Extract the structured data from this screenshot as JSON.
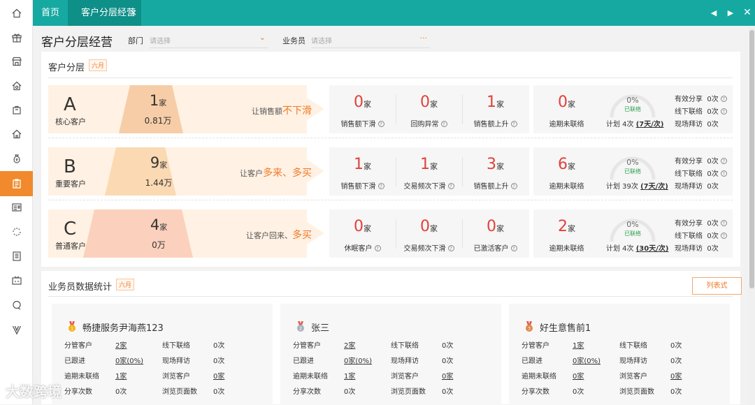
{
  "tabs": {
    "home": "首页",
    "current": "客户分层经营",
    "close": "×"
  },
  "page": {
    "title": "客户分层经营"
  },
  "filters": {
    "dept_label": "部门",
    "dept_placeholder": "请选择",
    "sales_label": "业务员",
    "sales_placeholder": "请选择",
    "sales_dots": "···"
  },
  "tiering": {
    "title": "客户分层",
    "month": "六月",
    "rows": [
      {
        "letter": "A",
        "name": "核心客户",
        "count": "1",
        "unit": "家",
        "amount": "0.81万",
        "slogan_pre": "让销售额",
        "slogan_hl": "不下滑",
        "metrics": [
          {
            "value": "0",
            "unit": "家",
            "label": "销售额下滑"
          },
          {
            "value": "0",
            "unit": "家",
            "label": "回购异常"
          },
          {
            "value": "1",
            "unit": "家",
            "label": "销售额上升"
          }
        ],
        "overdue": {
          "value": "0",
          "unit": "家",
          "label": "逾期未联络"
        },
        "gauge": {
          "pct": "0%",
          "tag": "已联络",
          "percent": 0
        },
        "plan_pre": "计划 4次 ",
        "plan_link": "(7天/次)",
        "stats": [
          {
            "label": "有效分享",
            "value": "0次"
          },
          {
            "label": "线下联络",
            "value": "0次"
          },
          {
            "label": "现场拜访",
            "value": "0次"
          }
        ]
      },
      {
        "letter": "B",
        "name": "重要客户",
        "count": "9",
        "unit": "家",
        "amount": "1.44万",
        "slogan_pre": "让客户",
        "slogan_hl": "多来、多买",
        "metrics": [
          {
            "value": "1",
            "unit": "家",
            "label": "销售额下滑"
          },
          {
            "value": "1",
            "unit": "家",
            "label": "交易频次下滑"
          },
          {
            "value": "3",
            "unit": "家",
            "label": "销售额上升"
          }
        ],
        "overdue": {
          "value": "6",
          "unit": "家",
          "label": "逾期未联络"
        },
        "gauge": {
          "pct": "0%",
          "tag": "已联络",
          "percent": 0
        },
        "plan_pre": "计划 39次 ",
        "plan_link": "(7天/次)",
        "stats": [
          {
            "label": "有效分享",
            "value": "0次"
          },
          {
            "label": "线下联络",
            "value": "0次"
          },
          {
            "label": "现场拜访",
            "value": "0次"
          }
        ]
      },
      {
        "letter": "C",
        "name": "普通客户",
        "count": "4",
        "unit": "家",
        "amount": "0万",
        "slogan_pre": "让客户回来、",
        "slogan_hl": "多买",
        "metrics": [
          {
            "value": "0",
            "unit": "家",
            "label": "休眠客户"
          },
          {
            "value": "0",
            "unit": "家",
            "label": "交易频次下滑"
          },
          {
            "value": "0",
            "unit": "家",
            "label": "已激活客户"
          }
        ],
        "overdue": {
          "value": "2",
          "unit": "家",
          "label": "逾期未联络"
        },
        "gauge": {
          "pct": "0%",
          "tag": "已联络",
          "percent": 0
        },
        "plan_pre": "计划 4次 ",
        "plan_link": "(30天/次)",
        "stats": [
          {
            "label": "有效分享",
            "value": "0次"
          },
          {
            "label": "线下联络",
            "value": "0次"
          },
          {
            "label": "现场拜访",
            "value": "0次"
          }
        ]
      }
    ]
  },
  "sales_stats": {
    "title": "业务员数据统计",
    "month": "六月",
    "list_button": "列表式",
    "cards": [
      {
        "name": "畅捷服务尹海燕123",
        "rank_color": "#f2b51c",
        "kv": [
          {
            "k": "分管客户",
            "v": "2家"
          },
          {
            "k": "线下联络",
            "v": "0次"
          },
          {
            "k": "已跟进",
            "v": "0家(0%)"
          },
          {
            "k": "现场拜访",
            "v": "0次"
          },
          {
            "k": "逾期未联络",
            "v": "1家"
          },
          {
            "k": "浏览客户",
            "v": "0家"
          },
          {
            "k": "分享次数",
            "v": "0次"
          },
          {
            "k": "浏览页面数",
            "v": "0次"
          }
        ]
      },
      {
        "name": "张三",
        "rank_color": "#a9b3bd",
        "kv": [
          {
            "k": "分管客户",
            "v": "2家"
          },
          {
            "k": "线下联络",
            "v": "0次"
          },
          {
            "k": "已跟进",
            "v": "0家(0%)"
          },
          {
            "k": "现场拜访",
            "v": "0次"
          },
          {
            "k": "逾期未联络",
            "v": "1家"
          },
          {
            "k": "浏览客户",
            "v": "0家"
          },
          {
            "k": "分享次数",
            "v": "0次"
          },
          {
            "k": "浏览页面数",
            "v": "0次"
          }
        ]
      },
      {
        "name": "好生意售前1",
        "rank_color": "#e0894a",
        "kv": [
          {
            "k": "分管客户",
            "v": "1家"
          },
          {
            "k": "线下联络",
            "v": "0次"
          },
          {
            "k": "已跟进",
            "v": "0家(0%)"
          },
          {
            "k": "现场拜访",
            "v": "0次"
          },
          {
            "k": "逾期未联络",
            "v": "0家"
          },
          {
            "k": "浏览客户",
            "v": "0家"
          },
          {
            "k": "分享次数",
            "v": "0次"
          },
          {
            "k": "浏览页面数",
            "v": "0次"
          }
        ]
      }
    ]
  },
  "watermark": "大数跨境",
  "colors": {
    "teal": "#16a9a2",
    "orange": "#f07a26",
    "red": "#e2413a",
    "green": "#2e9e50"
  },
  "sidebar_icons": [
    "home-icon",
    "gift-icon",
    "store-icon",
    "settings-house-icon",
    "bag-icon",
    "building-icon",
    "money-bag-icon",
    "clipboard-icon",
    "card-icon",
    "refresh-circle-icon",
    "document-icon",
    "tv-icon",
    "chat-icon",
    "v-icon"
  ]
}
